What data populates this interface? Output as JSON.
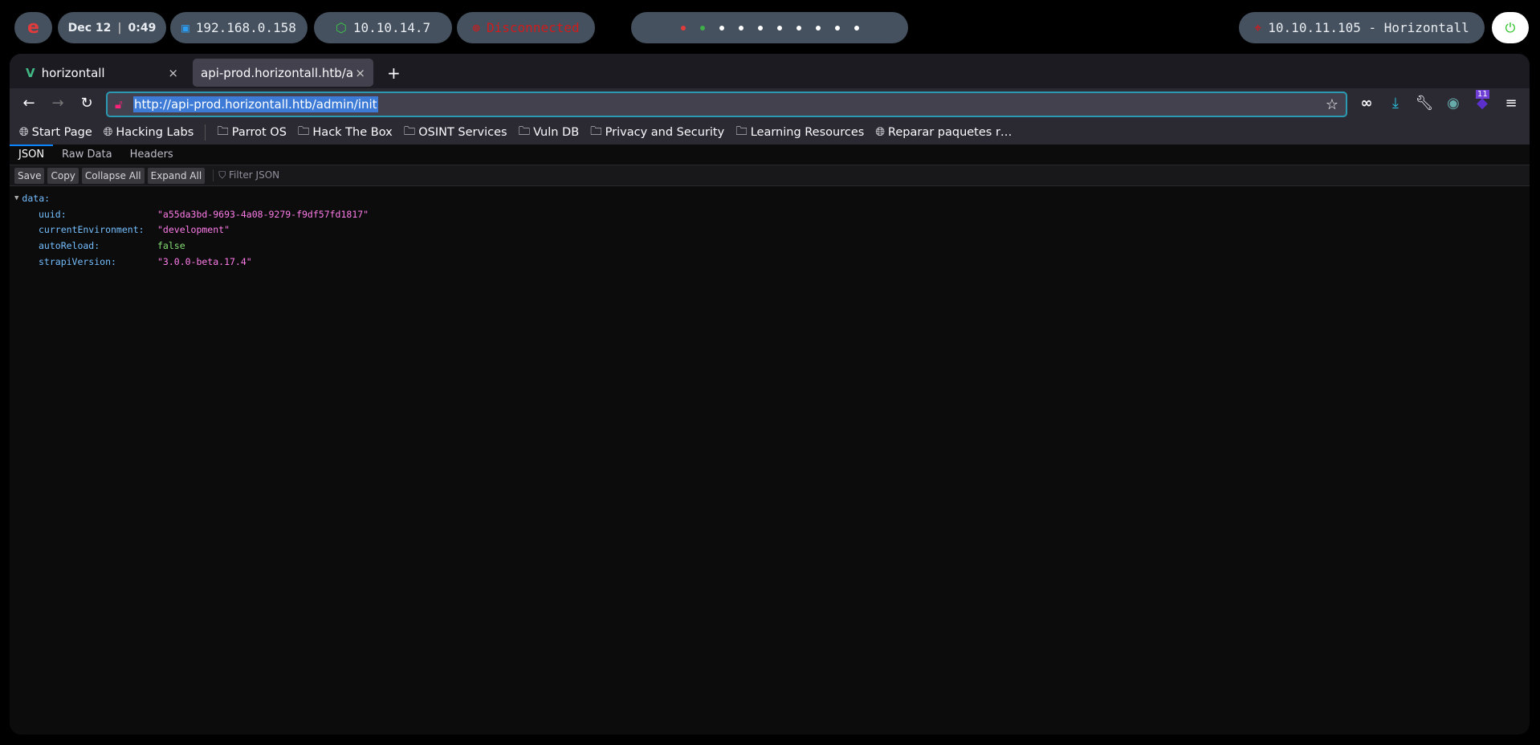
{
  "topbar": {
    "logo": "e",
    "date": "Dec 12",
    "time": "0:49",
    "local_ip": "192.168.0.158",
    "vpn_ip": "10.10.14.7",
    "status": "Disconnected",
    "target": "10.10.11.105 - Horizontall",
    "workspace_dots": [
      "#e23b3b",
      "#3fae49",
      "#ffffff",
      "#ffffff",
      "#ffffff",
      "#ffffff",
      "#ffffff",
      "#ffffff",
      "#ffffff",
      "#ffffff"
    ]
  },
  "browser": {
    "tabs": [
      {
        "label": "horizontall"
      },
      {
        "label": "api-prod.horizontall.htb/adm"
      }
    ],
    "url": "http://api-prod.horizontall.htb/admin/init",
    "extension_badge": "11",
    "bookmarks": [
      {
        "label": "Start Page",
        "icon": "globe"
      },
      {
        "label": "Hacking Labs",
        "icon": "globe"
      },
      {
        "label": "Parrot OS",
        "icon": "folder"
      },
      {
        "label": "Hack The Box",
        "icon": "folder"
      },
      {
        "label": "OSINT Services",
        "icon": "folder"
      },
      {
        "label": "Vuln DB",
        "icon": "folder"
      },
      {
        "label": "Privacy and Security",
        "icon": "folder"
      },
      {
        "label": "Learning Resources",
        "icon": "folder"
      },
      {
        "label": "Reparar paquetes r…",
        "icon": "globe"
      }
    ]
  },
  "viewer": {
    "tabs": [
      "JSON",
      "Raw Data",
      "Headers"
    ],
    "buttons": [
      "Save",
      "Copy",
      "Collapse All",
      "Expand All"
    ],
    "filter_placeholder": "Filter JSON",
    "root_key": "data:",
    "rows": [
      {
        "key": "uuid:",
        "value": "\"a55da3bd-9693-4a08-9279-f9df57fd1817\"",
        "type": "string"
      },
      {
        "key": "currentEnvironment:",
        "value": "\"development\"",
        "type": "string"
      },
      {
        "key": "autoReload:",
        "value": "false",
        "type": "bool"
      },
      {
        "key": "strapiVersion:",
        "value": "\"3.0.0-beta.17.4\"",
        "type": "string"
      }
    ]
  }
}
